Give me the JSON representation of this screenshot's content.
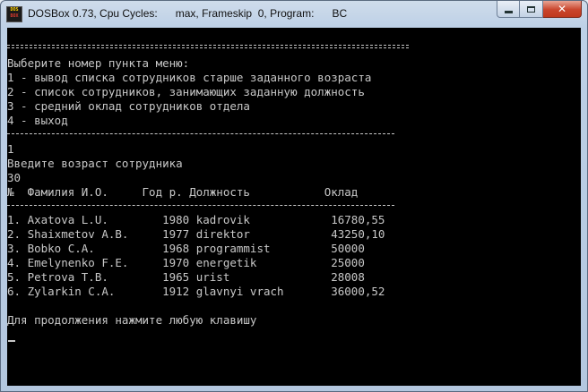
{
  "window": {
    "title": "DOSBox 0.73, Cpu Cycles:      max, Frameskip  0, Program:      BC",
    "icon_top": "DOS",
    "icon_bottom": "BOX",
    "controls": [
      "minimize-icon",
      "maximize-icon",
      "close-icon"
    ],
    "close_glyph": "✕"
  },
  "console": {
    "menu_prompt": "Выберите номер пункта меню:",
    "menu_items": [
      "1 - вывод списка сотрудников старше заданного возраста",
      "2 - список сотрудников, занимающих заданную должность",
      "3 - средний оклад сотрудников отдела",
      "4 - выход"
    ],
    "user_choice": "1",
    "age_prompt": "Введите возраст сотрудника",
    "age_value": "30",
    "table_header": "№  Фамилия И.О.     Год р. Должность           Оклад",
    "rows": [
      "1. Axatova L.U.        1980 kadrovik            16780,55",
      "2. Shaixmetov A.B.     1977 direktor            43250,10",
      "3. Bobko C.A.          1968 programmist         50000",
      "4. Emelynenko F.E.     1970 energetik           25000",
      "5. Petrova T.B.        1965 urist               28008",
      "6. Zylarkin C.A.       1912 glavnyi vrach       36000,52"
    ],
    "continue_prompt": "Для продолжения нажмите любую клавишу"
  }
}
